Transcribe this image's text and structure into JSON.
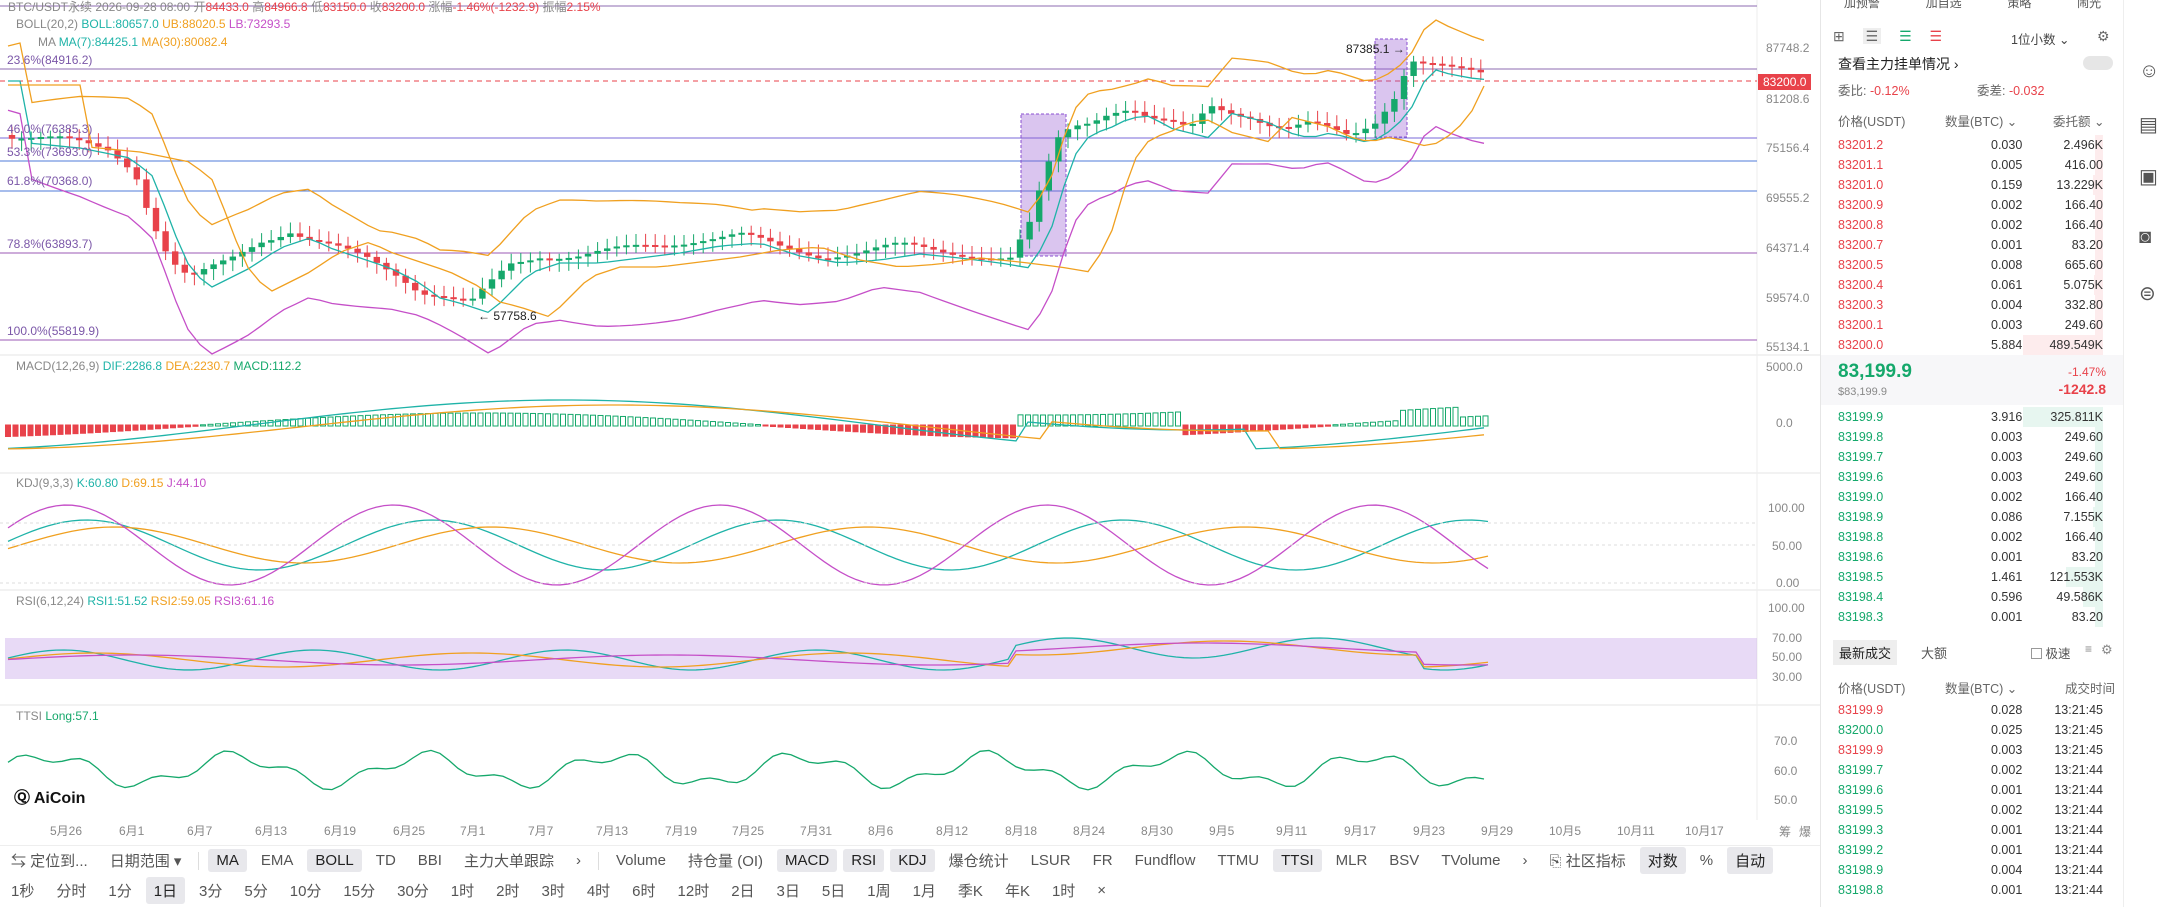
{
  "header": {
    "pair": "BTC/USDT永续 2026-09-28 08:00",
    "open_lbl": "开",
    "open": "84433.0",
    "high_lbl": "高",
    "high": "84966.8",
    "low_lbl": "低",
    "low": "83150.0",
    "close_lbl": "收",
    "close": "83200.0",
    "chg_lbl": "涨幅",
    "chg": "-1.46%(-1232.9)",
    "amp_lbl": "振幅",
    "amp": "2.15%"
  },
  "boll": {
    "label": "BOLL(20,2)",
    "boll": "BOLL:80657.0",
    "ub": "UB:88020.5",
    "lb": "LB:73293.5"
  },
  "ma": {
    "label": "MA",
    "ma7": "MA(7):84425.1",
    "ma30": "MA(30):80082.4"
  },
  "fib": [
    "23.6%(84916.2)",
    "46.0%(76385.3)",
    "53.3%(73693.0)",
    "61.8%(70368.0)",
    "78.8%(63893.7)",
    "100.0%(55819.9)"
  ],
  "price_axis": [
    "87748.2",
    "81208.6",
    "75156.4",
    "69555.2",
    "64371.4",
    "59574.0",
    "55134.1"
  ],
  "current_price_tag": "83200.0",
  "annotations": {
    "high": "87385.1",
    "low": "57758.6"
  },
  "macd": {
    "label": "MACD(12,26,9)",
    "dif": "DIF:2286.8",
    "dea": "DEA:2230.7",
    "macd": "MACD:112.2",
    "axis": [
      "5000.0",
      "0.0"
    ]
  },
  "kdj": {
    "label": "KDJ(9,3,3)",
    "k": "K:60.80",
    "d": "D:69.15",
    "j": "J:44.10",
    "axis": [
      "100.00",
      "50.00",
      "0.00"
    ]
  },
  "rsi": {
    "label": "RSI(6,12,24)",
    "r1": "RSI1:51.52",
    "r2": "RSI2:59.05",
    "r3": "RSI3:61.16",
    "axis": [
      "100.00",
      "70.00",
      "50.00",
      "30.00"
    ]
  },
  "ttsi": {
    "label": "TTSI",
    "long": "Long:57.1",
    "axis": [
      "70.0",
      "60.0",
      "50.0"
    ]
  },
  "logo": "AiCoin",
  "xaxis": [
    "5月26",
    "6月1",
    "6月7",
    "6月13",
    "6月19",
    "6月25",
    "7月1",
    "7月7",
    "7月13",
    "7月19",
    "7月25",
    "7月31",
    "8月6",
    "8月12",
    "8月18",
    "8月24",
    "8月30",
    "9月5",
    "9月11",
    "9月17",
    "9月23",
    "9月29",
    "10月5",
    "10月11",
    "10月17"
  ],
  "corner_labels": [
    "筹",
    "爆"
  ],
  "toolbar1": [
    "定位到...",
    "日期范围",
    "MA",
    "EMA",
    "BOLL",
    "TD",
    "BBI",
    "主力大单跟踪",
    "Volume",
    "持仓量 (OI)",
    "MACD",
    "RSI",
    "KDJ",
    "爆仓统计",
    "LSUR",
    "FR",
    "Fundflow",
    "TTMU",
    "TTSI",
    "MLR",
    "BSV",
    "TVolume",
    "社区指标",
    "对数",
    "%",
    "自动"
  ],
  "toolbar2": [
    "1秒",
    "分时",
    "1分",
    "1日",
    "3分",
    "5分",
    "10分",
    "15分",
    "30分",
    "1时",
    "2时",
    "3时",
    "4时",
    "6时",
    "12时",
    "2日",
    "3日",
    "5日",
    "1周",
    "1月",
    "季K",
    "年K",
    "1时",
    "×"
  ],
  "sidebar": {
    "top_buttons": [
      "加预警",
      "加自选",
      "策略",
      "闹光"
    ],
    "decimals": "1位小数",
    "title": "查看主力挂单情况",
    "ratio_lbl": "委比:",
    "ratio": "-0.12%",
    "diff_lbl": "委差:",
    "diff": "-0.032",
    "col_price": "价格(USDT)",
    "col_qty": "数量(BTC)",
    "col_total": "委托额",
    "asks": [
      [
        "83201.2",
        "0.030",
        "2.496K"
      ],
      [
        "83201.1",
        "0.005",
        "416.00"
      ],
      [
        "83201.0",
        "0.159",
        "13.229K"
      ],
      [
        "83200.9",
        "0.002",
        "166.40"
      ],
      [
        "83200.8",
        "0.002",
        "166.40"
      ],
      [
        "83200.7",
        "0.001",
        "83.20"
      ],
      [
        "83200.5",
        "0.008",
        "665.60"
      ],
      [
        "83200.4",
        "0.061",
        "5.075K"
      ],
      [
        "83200.3",
        "0.004",
        "332.80"
      ],
      [
        "83200.1",
        "0.003",
        "249.60"
      ],
      [
        "83200.0",
        "5.884",
        "489.549K"
      ]
    ],
    "last_price": "83,199.9",
    "last_sub": "$83,199.9",
    "last_pct": "-1.47%",
    "last_chg": "-1242.8",
    "bids": [
      [
        "83199.9",
        "3.916",
        "325.811K"
      ],
      [
        "83199.8",
        "0.003",
        "249.60"
      ],
      [
        "83199.7",
        "0.003",
        "249.60"
      ],
      [
        "83199.6",
        "0.003",
        "249.60"
      ],
      [
        "83199.0",
        "0.002",
        "166.40"
      ],
      [
        "83198.9",
        "0.086",
        "7.155K"
      ],
      [
        "83198.8",
        "0.002",
        "166.40"
      ],
      [
        "83198.6",
        "0.001",
        "83.20"
      ],
      [
        "83198.5",
        "1.461",
        "121.553K"
      ],
      [
        "83198.4",
        "0.596",
        "49.586K"
      ],
      [
        "83198.3",
        "0.001",
        "83.20"
      ]
    ],
    "trades_tab": "最新成交",
    "big_tab": "大额",
    "fast_lbl": "极速",
    "t_col_price": "价格(USDT)",
    "t_col_qty": "数量(BTC)",
    "t_col_time": "成交时间",
    "trades": [
      [
        "83199.9",
        "0.028",
        "13:21:45",
        "red"
      ],
      [
        "83200.0",
        "0.025",
        "13:21:45",
        "green"
      ],
      [
        "83199.9",
        "0.003",
        "13:21:45",
        "red"
      ],
      [
        "83199.7",
        "0.002",
        "13:21:44",
        "green"
      ],
      [
        "83199.6",
        "0.001",
        "13:21:44",
        "green"
      ],
      [
        "83199.5",
        "0.002",
        "13:21:44",
        "green"
      ],
      [
        "83199.3",
        "0.001",
        "13:21:44",
        "green"
      ],
      [
        "83199.2",
        "0.001",
        "13:21:44",
        "green"
      ],
      [
        "83198.9",
        "0.004",
        "13:21:44",
        "green"
      ],
      [
        "83198.8",
        "0.001",
        "13:21:44",
        "green"
      ]
    ]
  },
  "colors": {
    "up": "#15a86b",
    "down": "#e8424a",
    "boll_mid": "#1fb3a8",
    "boll_band": "#c54fc8",
    "ma_orange": "#f0a020",
    "fib": "#7b57a8"
  }
}
